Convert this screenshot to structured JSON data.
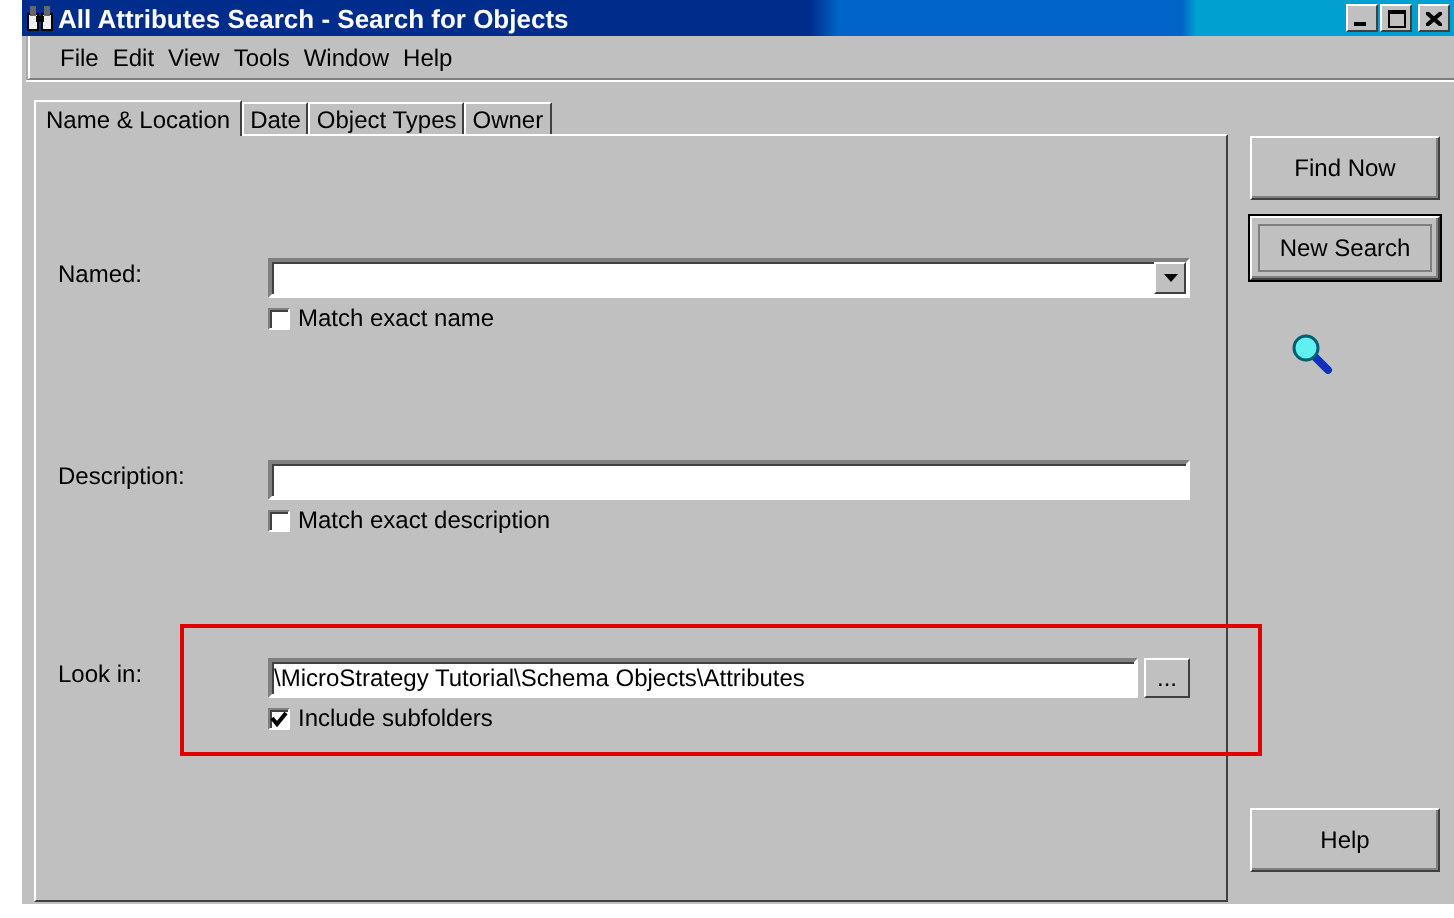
{
  "window": {
    "title": "All Attributes Search - Search for Objects"
  },
  "menu": [
    "File",
    "Edit",
    "View",
    "Tools",
    "Window",
    "Help"
  ],
  "tabs": [
    {
      "label": "Name & Location",
      "selected": true
    },
    {
      "label": "Date",
      "selected": false
    },
    {
      "label": "Object Types",
      "selected": false
    },
    {
      "label": "Owner",
      "selected": false
    }
  ],
  "named": {
    "label": "Named:",
    "dropdown": true,
    "checkbox": {
      "label": "Match exact name",
      "checked": false
    }
  },
  "description": {
    "label": "Description:",
    "dropdown": false,
    "checkbox": {
      "label": "Match exact description",
      "checked": false
    }
  },
  "look_in": {
    "label": "Look in:",
    "value": "\\MicroStrategy Tutorial\\Schema Objects\\Attributes",
    "browse": "...",
    "highlighted": true,
    "checkbox": {
      "label": "Include subfolders",
      "checked": true
    }
  },
  "buttons": [
    {
      "label": "Find Now",
      "default": false
    },
    {
      "label": "New Search",
      "default": true
    }
  ],
  "help_button": "Help"
}
